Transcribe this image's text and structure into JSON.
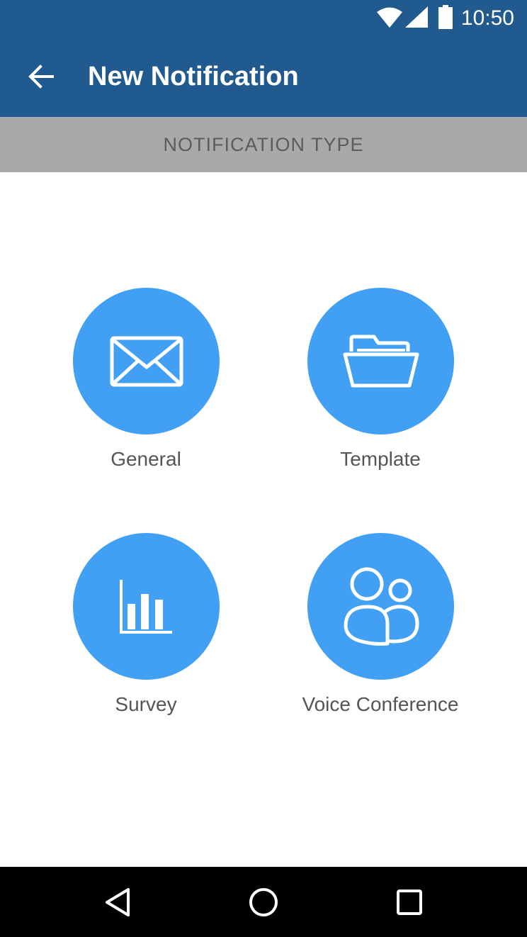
{
  "status_bar": {
    "time": "10:50",
    "icons": [
      "wifi-icon",
      "cellular-signal-icon",
      "battery-icon"
    ]
  },
  "toolbar": {
    "back_icon": "arrow-back-icon",
    "title": "New Notification"
  },
  "section": {
    "header": "NOTIFICATION TYPE"
  },
  "notification_types": [
    {
      "label": "General",
      "icon": "envelope-icon"
    },
    {
      "label": "Template",
      "icon": "folder-icon"
    },
    {
      "label": "Survey",
      "icon": "bar-chart-icon"
    },
    {
      "label": "Voice Conference",
      "icon": "users-icon"
    }
  ],
  "nav_bar": {
    "icons": [
      "back-triangle-icon",
      "home-circle-icon",
      "recents-square-icon"
    ]
  },
  "colors": {
    "app_bar": "#215a8e",
    "section_header_bg": "#a9a9a9",
    "accent_circle": "#42a0f4",
    "label_text": "#555555"
  }
}
